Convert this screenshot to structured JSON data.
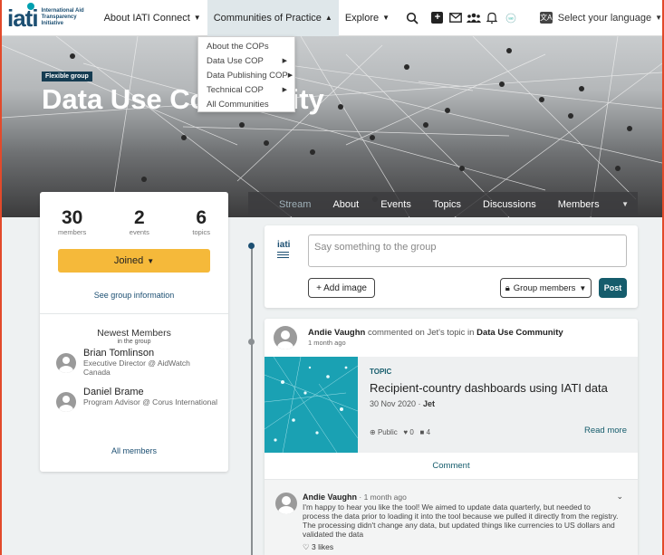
{
  "navbar": {
    "logo_mark": "iati",
    "logo_text": "International Aid Transparency Initiative",
    "menu": [
      {
        "label": "About IATI Connect"
      },
      {
        "label": "Communities of Practice"
      },
      {
        "label": "Explore"
      }
    ],
    "language_label": "Select your language"
  },
  "dropdown": {
    "items": [
      "About the COPs",
      "Data Use COP",
      "Data Publishing COP",
      "Technical COP",
      "All Communities"
    ]
  },
  "hero": {
    "badge": "Flexible group",
    "title": "Data Use Community"
  },
  "group_card": {
    "stats": [
      {
        "value": "30",
        "label": "members"
      },
      {
        "value": "2",
        "label": "events"
      },
      {
        "value": "6",
        "label": "topics"
      }
    ],
    "joined_label": "Joined",
    "see_info": "See group information",
    "newest_heading": "Newest Members",
    "newest_sub": "in the group",
    "members": [
      {
        "name": "Brian Tomlinson",
        "role": "Executive Director @ AidWatch Canada"
      },
      {
        "name": "Daniel Brame",
        "role": "Program Advisor @ Corus International"
      }
    ],
    "all_members": "All members"
  },
  "tabs": [
    "Stream",
    "About",
    "Events",
    "Topics",
    "Discussions",
    "Members"
  ],
  "post_box": {
    "logo": "iati",
    "placeholder": "Say something to the group",
    "add_image": "+ Add image",
    "visibility": "Group members",
    "post_label": "Post"
  },
  "activity": {
    "actor": "Andie Vaughn",
    "verb": "commented on",
    "target": "Jet's topic in",
    "group": "Data Use Community",
    "time": "1 month ago",
    "topic": {
      "tag": "TOPIC",
      "title": "Recipient-country dashboards using IATI data",
      "date": "30 Nov 2020",
      "author": "Jet",
      "visibility": "Public",
      "likes": "0",
      "comments": "4",
      "read_more": "Read more"
    },
    "comment_link": "Comment",
    "comment": {
      "author": "Andie Vaughn",
      "time": "· 1 month ago",
      "text": "I'm happy to hear you like the tool! We aimed to update data quarterly, but needed to process the data prior to loading it into the tool because we pulled it directly from the registry. The processing didn't change any data, but updated things like currencies to US dollars and validated the data",
      "likes": "3 likes"
    }
  },
  "colors": {
    "brand_navy": "#1c4f72",
    "teal": "#155c6c",
    "joined_yellow": "#f5b93a",
    "frame_border": "#e24a2b"
  }
}
